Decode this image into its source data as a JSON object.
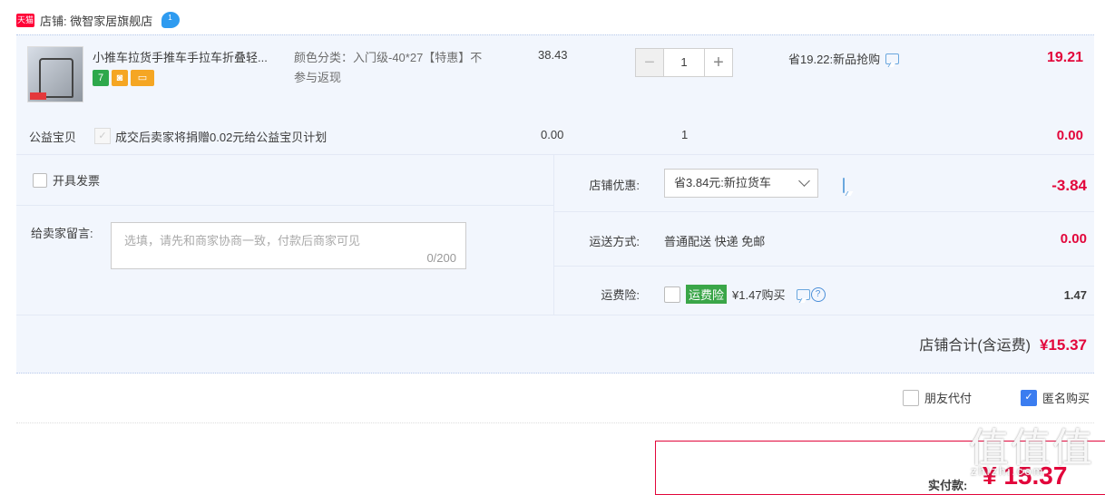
{
  "store": {
    "badge": "天猫",
    "name": "店铺: 微智家居旗舰店",
    "wangwang_icon": "wangwang-chat-icon"
  },
  "item": {
    "title": "小推车拉货手推车手拉车折叠轻...",
    "attr": "颜色分类：入门级-40*27【特惠】不参与返现",
    "price": "38.43",
    "qty": "1",
    "minus": "−",
    "plus": "+",
    "promo": "省19.22:新品抢购",
    "subtotal": "19.21",
    "icons": [
      "7",
      "◙",
      "▭"
    ]
  },
  "charity": {
    "label": "公益宝贝",
    "text": "成交后卖家将捐赠0.02元给公益宝贝计划",
    "price": "0.00",
    "qty": "1",
    "total": "0.00"
  },
  "options": {
    "invoice_label": "开具发票",
    "message_label": "给卖家留言:",
    "message_placeholder": "选填，请先和商家协商一致，付款后商家可见",
    "message_count": "0/200",
    "discount_label": "店铺优惠:",
    "discount_value": "省3.84元:新拉货车",
    "discount_amount": "-3.84",
    "shipping_label": "运送方式:",
    "shipping_value": "普通配送 快递 免邮",
    "shipping_amount": "0.00",
    "insurance_label": "运费险:",
    "insurance_badge": "运费险",
    "insurance_price": "¥1.47购买",
    "insurance_amount": "1.47",
    "store_total_label": "店铺合计(含运费)",
    "store_total_amount": "¥15.37"
  },
  "bottom": {
    "friend_pay": "朋友代付",
    "anonymous": "匿名购买",
    "pay_label": "实付款:",
    "pay_amount": "¥ 15.37"
  },
  "watermark": {
    "main": "值值值",
    "sub": "zhizhi.com"
  },
  "colors": {
    "price_red": "#e2063b",
    "panel_bg": "#f2f6fd",
    "tmall_red": "#ff0036",
    "checkbox_blue": "#3b7df0"
  }
}
